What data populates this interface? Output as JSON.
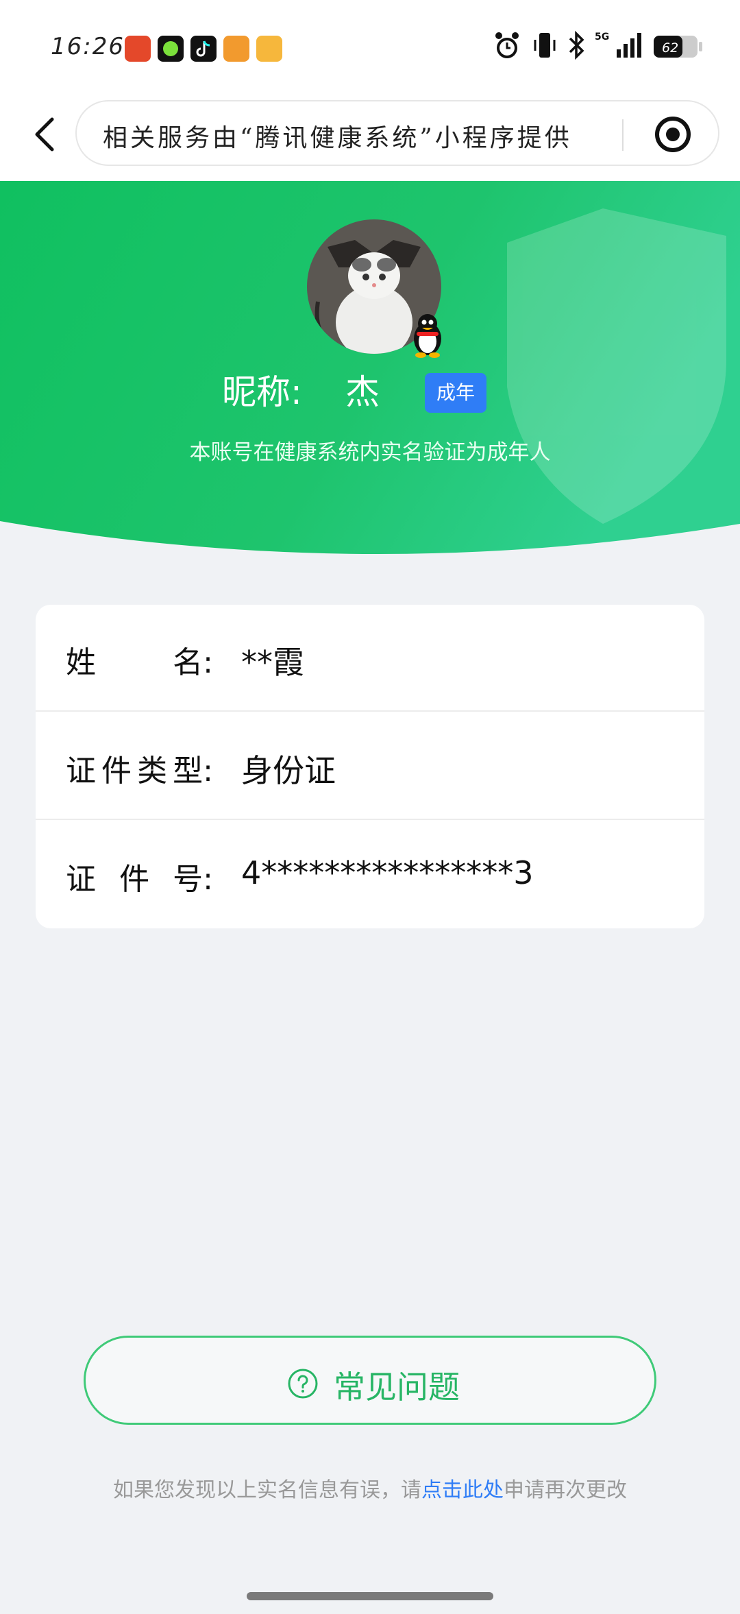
{
  "status_bar": {
    "time": "16:26",
    "battery": "62",
    "network": "5G"
  },
  "header": {
    "notice": "相关服务由“腾讯健康系统”小程序提供",
    "back_icon": "chevron-left-icon",
    "record_icon": "record-icon"
  },
  "hero": {
    "nickname_label": "昵称:",
    "nickname": "杰",
    "badge": "成年",
    "verify_text": "本账号在健康系统内实名验证为成年人",
    "bg_color": "#1fc770"
  },
  "card": {
    "rows": [
      {
        "label_chars": [
          "姓",
          "名:"
        ],
        "value": "**霞"
      },
      {
        "label_chars": [
          "证",
          "件",
          "类",
          "型:"
        ],
        "value": "身份证"
      },
      {
        "label_chars": [
          "证",
          "件",
          "号:"
        ],
        "value": "4****************3"
      }
    ]
  },
  "faq": {
    "label": "常见问题",
    "icon": "question-circle-icon",
    "color": "#27b565"
  },
  "footer": {
    "prefix": "如果您发现以上实名信息有误，请",
    "link": "点击此处",
    "suffix": "申请再次更改"
  }
}
